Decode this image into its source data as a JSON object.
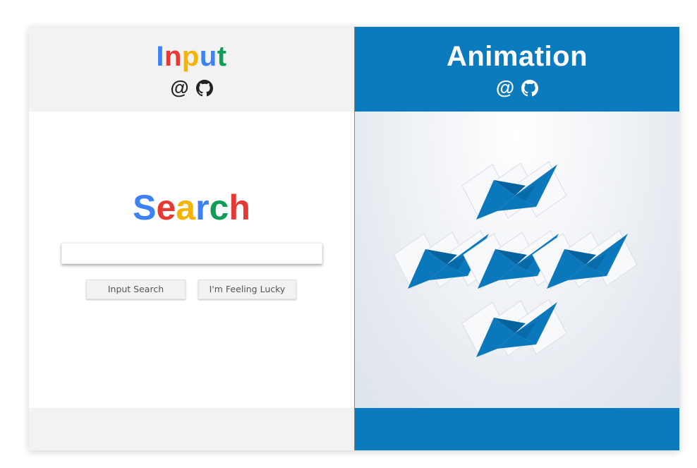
{
  "left_panel": {
    "title_letters": [
      "I",
      "n",
      "p",
      "u",
      "t"
    ],
    "title_colors": [
      "#3b82f6",
      "#e53935",
      "#f4b400",
      "#3b82f6",
      "#0f9d58"
    ],
    "links": {
      "at_label": "@",
      "github_icon": "github-icon"
    },
    "search_title_letters": [
      "S",
      "e",
      "a",
      "r",
      "c",
      "h"
    ],
    "search_title_colors": [
      "#3b82f6",
      "#e53935",
      "#f4b400",
      "#3b82f6",
      "#0f9d58",
      "#e53935"
    ],
    "search_input": {
      "value": "",
      "placeholder": ""
    },
    "buttons": {
      "search": "Input Search",
      "lucky": "I'm Feeling Lucky"
    }
  },
  "right_panel": {
    "title": "Animation",
    "links": {
      "at_label": "@",
      "github_icon": "github-icon"
    },
    "accent_color": "#0b7bbd"
  }
}
